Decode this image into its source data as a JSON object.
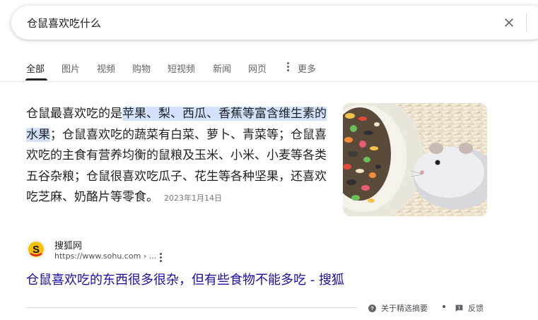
{
  "search": {
    "query": "仓鼠喜欢吃什么"
  },
  "tabs": [
    {
      "label": "全部",
      "active": true
    },
    {
      "label": "图片"
    },
    {
      "label": "视频"
    },
    {
      "label": "购物"
    },
    {
      "label": "短视频"
    },
    {
      "label": "新闻"
    },
    {
      "label": "网页"
    },
    {
      "label": "更多"
    }
  ],
  "snippet": {
    "lead": "仓鼠最喜欢吃的是",
    "highlight": "苹果、梨、西瓜、香蕉等富含维生素的水果",
    "rest": "；仓鼠喜欢吃的蔬菜有白菜、萝卜、青菜等；仓鼠喜欢吃的主食有营养均衡的鼠粮及玉米、小米、小麦等各类五谷杂粮；仓鼠很喜欢吃瓜子、花生等各种坚果，还喜欢吃芝麻、奶酪片等零食。",
    "date": "2023年1月14日"
  },
  "source": {
    "name": "搜狐网",
    "url": "https://www.sohu.com › ..."
  },
  "result": {
    "title": "仓鼠喜欢吃的东西很多很杂，但有些食物不能多吃 - 搜狐"
  },
  "footer": {
    "about": "关于精选摘要",
    "feedback": "反馈"
  },
  "colors": {
    "link": "#1a0dab",
    "highlight": "#d3e3fd",
    "text": "#202124",
    "muted": "#70757a"
  }
}
